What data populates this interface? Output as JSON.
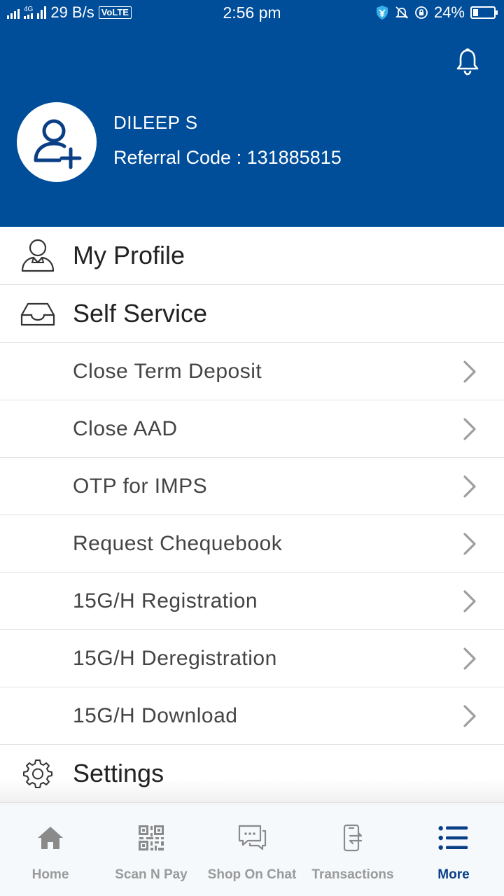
{
  "status_bar": {
    "network_type": "4G",
    "speed": "29 B/s",
    "volte": "VoLTE",
    "time": "2:56 pm",
    "battery_percent": "24%",
    "battery_level": 0.24
  },
  "profile": {
    "name": "DILEEP S",
    "referral_label": "Referral Code : ",
    "referral_code": "131885815"
  },
  "menu": {
    "my_profile": "My Profile",
    "self_service": "Self Service",
    "sub_items": [
      "Close Term Deposit",
      "Close AAD",
      "OTP for IMPS",
      "Request Chequebook",
      "15G/H Registration",
      "15G/H Deregistration",
      "15G/H Download"
    ],
    "settings": "Settings"
  },
  "bottom_nav": {
    "items": [
      {
        "label": "Home",
        "icon": "home-icon"
      },
      {
        "label": "Scan N Pay",
        "icon": "qr-code-icon"
      },
      {
        "label": "Shop On Chat",
        "icon": "chat-icon"
      },
      {
        "label": "Transactions",
        "icon": "transactions-icon"
      },
      {
        "label": "More",
        "icon": "menu-list-icon"
      }
    ],
    "active_index": 4
  },
  "colors": {
    "brand_blue": "#004d9a",
    "active_nav": "#0a3f86",
    "inactive_nav": "#9a9a9a"
  }
}
